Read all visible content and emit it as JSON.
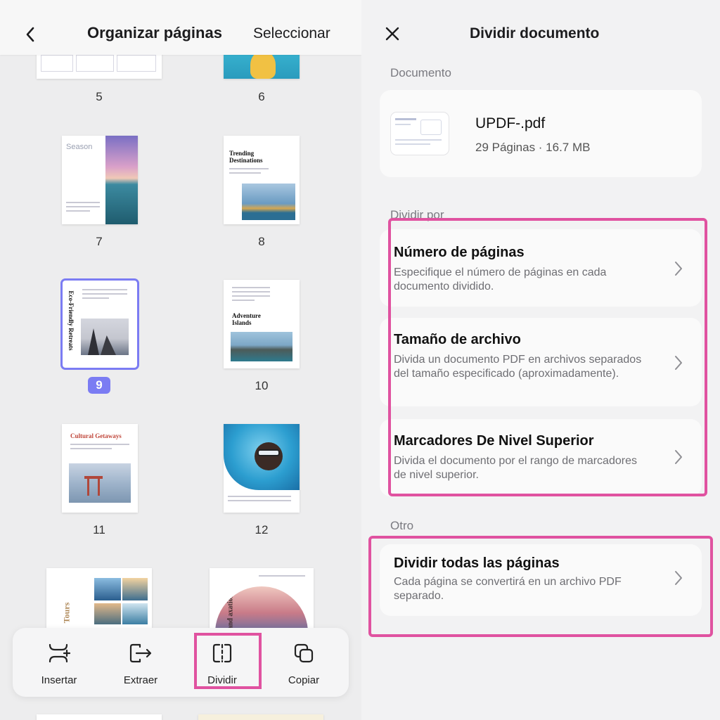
{
  "left": {
    "title": "Organizar páginas",
    "select_label": "Seleccionar",
    "pages": [
      {
        "num": "5"
      },
      {
        "num": "6"
      },
      {
        "num": "7",
        "heading": "Season"
      },
      {
        "num": "8",
        "heading": "Trending Destinations"
      },
      {
        "num": "9",
        "heading": "Eco-Friendly Retreats",
        "selected": true
      },
      {
        "num": "10",
        "heading": "Adventure Islands"
      },
      {
        "num": "11",
        "heading": "Cultural Getaways"
      },
      {
        "num": "12"
      }
    ],
    "partial_page_13_text": "Tours",
    "partial_page_14_text": "ness and axation",
    "toolbar": [
      {
        "label": "Insertar",
        "icon": "insert-icon"
      },
      {
        "label": "Extraer",
        "icon": "extract-icon"
      },
      {
        "label": "Dividir",
        "icon": "split-icon"
      },
      {
        "label": "Copiar",
        "icon": "copy-icon"
      }
    ]
  },
  "right": {
    "title": "Dividir documento",
    "section_document": "Documento",
    "document": {
      "name": "UPDF-.pdf",
      "meta": "29 Páginas · 16.7 MB"
    },
    "section_split_by": "Dividir por",
    "options": [
      {
        "title": "Número de páginas",
        "description": "Especifique el número de páginas en cada documento dividido."
      },
      {
        "title": "Tamaño de archivo",
        "description": "Divida un documento PDF en archivos separados del tamaño especificado (aproximadamente)."
      },
      {
        "title": "Marcadores De Nivel Superior",
        "description": "Divida el documento por el rango de marcadores de nivel superior."
      }
    ],
    "section_other": "Otro",
    "other_option": {
      "title": "Dividir todas las páginas",
      "description": "Cada página se convertirá en un archivo PDF separado."
    }
  },
  "colors": {
    "highlight": "#e052a0",
    "selection": "#7b7cf3"
  }
}
